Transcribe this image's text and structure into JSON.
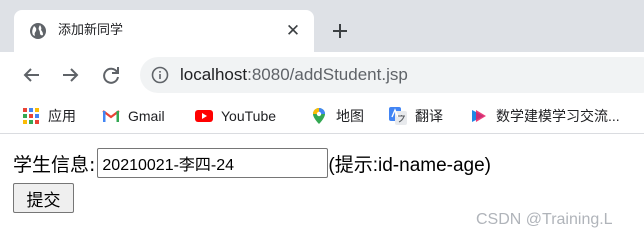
{
  "tab": {
    "title": "添加新同学",
    "close": "✕",
    "new_tab": "+"
  },
  "omnibox": {
    "host": "localhost",
    "rest": ":8080/addStudent.jsp"
  },
  "bookmarks": [
    {
      "label": "应用",
      "icon": "apps-grid-icon"
    },
    {
      "label": "Gmail",
      "icon": "gmail-icon"
    },
    {
      "label": "YouTube",
      "icon": "youtube-icon"
    },
    {
      "label": "地图",
      "icon": "maps-pin-icon"
    },
    {
      "label": "翻译",
      "icon": "translate-icon"
    },
    {
      "label": "数学建模学习交流...",
      "icon": "youku-icon"
    }
  ],
  "form": {
    "label": "学生信息:",
    "input_value": "20210021-李四-24",
    "hint": "(提示:id-name-age)",
    "submit_label": "提交"
  },
  "watermark": "CSDN @Training.L"
}
